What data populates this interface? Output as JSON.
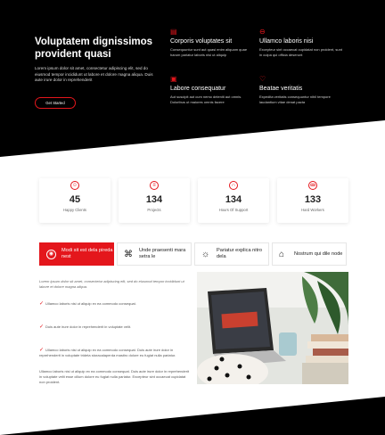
{
  "colors": {
    "accent": "#e4161c",
    "dark": "#000000"
  },
  "hero": {
    "title": "Voluptatem dignissimos provident quasi",
    "text": "Lorem ipsum dolor sit amet, consectetur adipiscing elit, sed do eiusmod tempor incididunt ut labore et dolore magna aliqua. Duis aute irure dolor in reprehenderit",
    "button": "Get Started",
    "features": [
      {
        "icon": "file-icon",
        "title": "Corporis voluptates sit",
        "text": "Consequuntur sunt aut quasi enim aliquam quae harum pariatur laboris nisi ut aliquip"
      },
      {
        "icon": "shield-icon",
        "title": "Ullamco laboris nisi",
        "text": "Excepteur sint occaecat cupidatat non proident, sunt in culpa qui officia deserunt"
      },
      {
        "icon": "chart-icon",
        "title": "Labore consequatur",
        "text": "Aut suscipit aut cum nemo deleniti aut omnis. Doloribus ut maiores omnis facere"
      },
      {
        "icon": "heart-icon",
        "title": "Beatae veritatis",
        "text": "Expedita veritatis consequuntur nihil tempore laudantium vitae denat pacta"
      }
    ]
  },
  "stats": [
    {
      "icon": "smile-icon",
      "value": "45",
      "label": "Happy Clients"
    },
    {
      "icon": "journal-icon",
      "value": "134",
      "label": "Projects"
    },
    {
      "icon": "headset-icon",
      "value": "134",
      "label": "Hours Of Support"
    },
    {
      "icon": "people-icon",
      "value": "133",
      "label": "Hard Workers"
    }
  ],
  "tabs": [
    {
      "icon": "target-icon",
      "label": "Modi sit est dela pireda nest",
      "active": true
    },
    {
      "icon": "box-icon",
      "label": "Unde praesenti mara setra le",
      "active": false
    },
    {
      "icon": "sun-icon",
      "label": "Pariatur explica nitro dela",
      "active": false
    },
    {
      "icon": "store-icon",
      "label": "Nostrum qui dile node",
      "active": false
    }
  ],
  "content": {
    "lead": "Lorem ipsum dolor sit amet, consectetur adipiscing elit, sed do eiusmod tempor incididunt ut labore et dolore magna aliqua.",
    "checks": [
      "Ullamco laboris nisi ut aliquip ex ea commodo consequat.",
      "Duis aute irure dolor in reprehenderit in voluptate velit.",
      "Ullamco laboris nisi ut aliquip ex ea commodo consequat. Duis aute irure dolor in reprehenderit in voluptate trideta storacalaperda mastiro dolore eu fugiat nulla pariatur."
    ],
    "paragraph": "Ullamco laboris nisi ut aliquip ex ea commodo consequat. Duis aute irure dolor in reprehenderit in voluptate velit esse cillum dolore eu fugiat nulla pariatur. Excepteur sint occaecat cupidatat non proident."
  }
}
